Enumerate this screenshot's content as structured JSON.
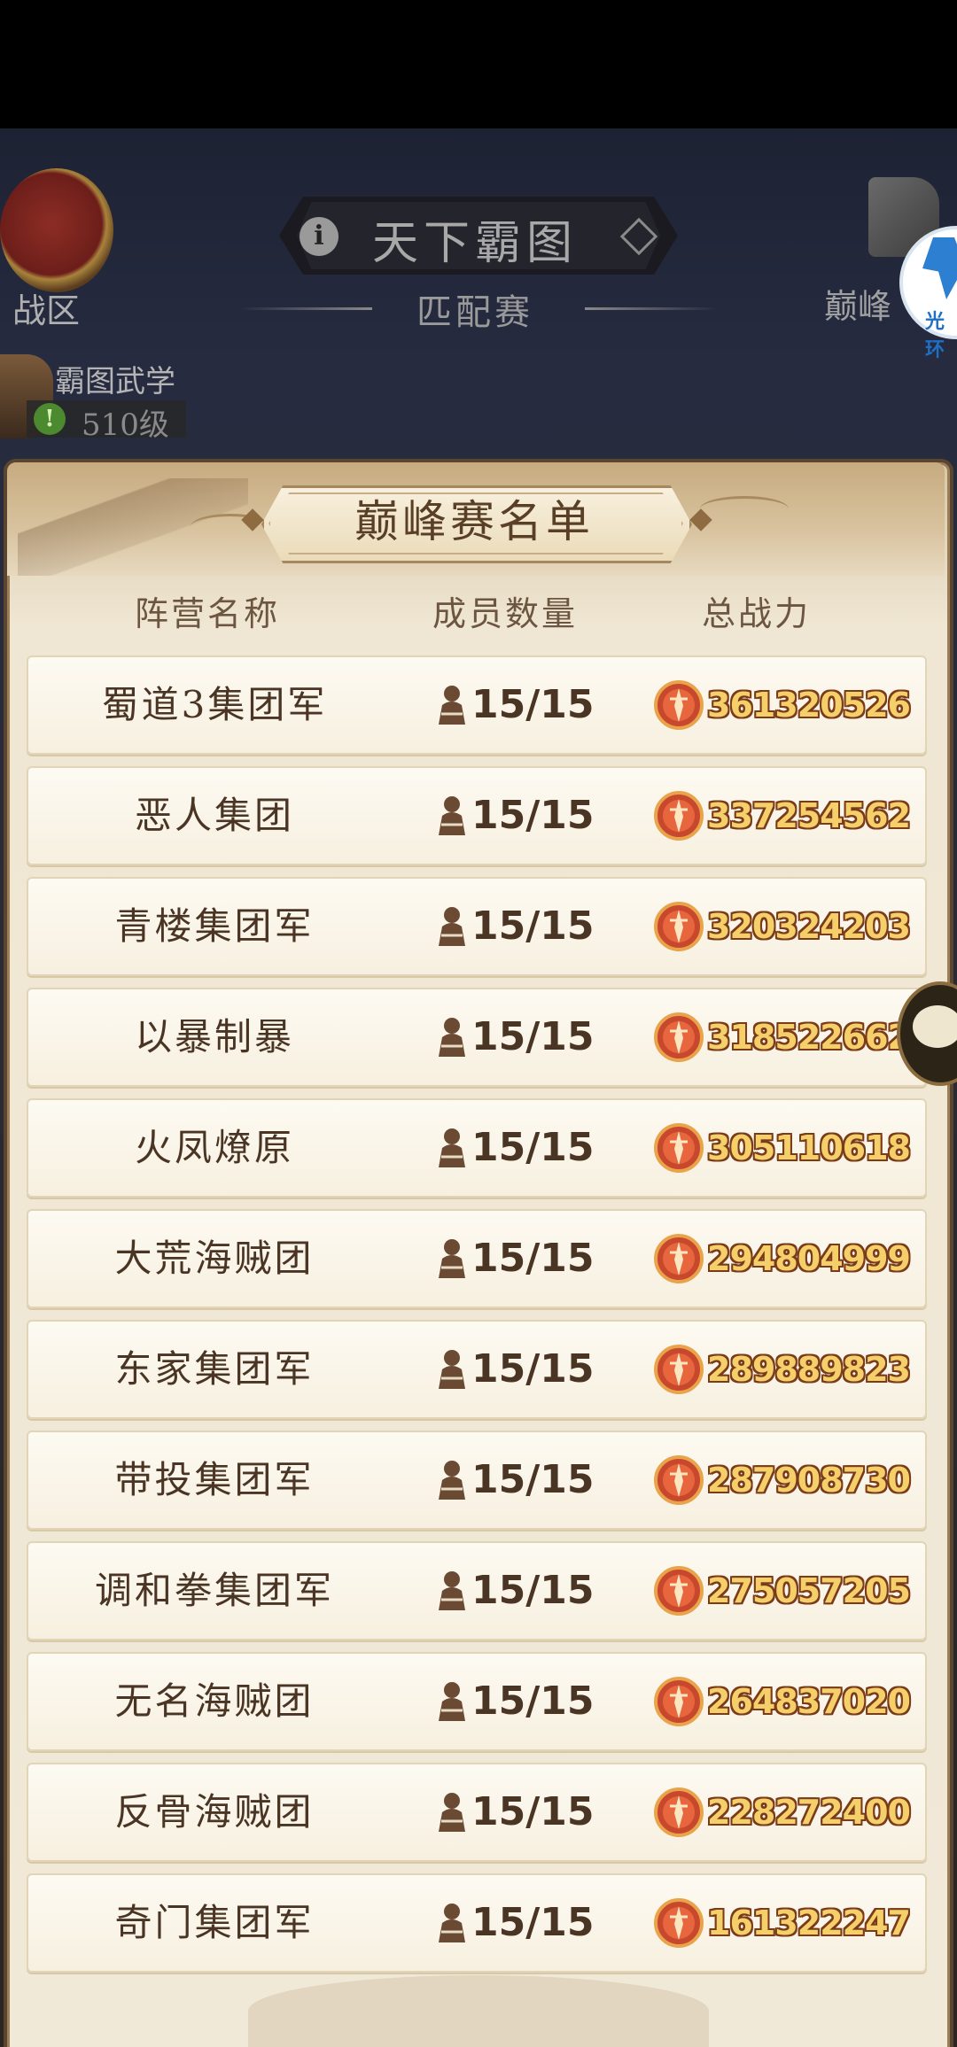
{
  "header": {
    "title": "天下霸图",
    "subtitle": "匹配赛",
    "zone_label": "战区",
    "peak_label": "巅峰",
    "side_app_text": "光环"
  },
  "martial": {
    "title": "霸图武学",
    "level": "510级"
  },
  "panel": {
    "title": "巅峰赛名单",
    "columns": [
      "阵营名称",
      "成员数量",
      "总战力"
    ]
  },
  "rows": [
    {
      "name": "蜀道3集团军",
      "members": "15/15",
      "power": "361320526"
    },
    {
      "name": "恶人集团",
      "members": "15/15",
      "power": "337254562"
    },
    {
      "name": "青楼集团军",
      "members": "15/15",
      "power": "320324203"
    },
    {
      "name": "以暴制暴",
      "members": "15/15",
      "power": "318522662"
    },
    {
      "name": "火凤燎原",
      "members": "15/15",
      "power": "305110618"
    },
    {
      "name": "大荒海贼团",
      "members": "15/15",
      "power": "294804999"
    },
    {
      "name": "东家集团军",
      "members": "15/15",
      "power": "289889823"
    },
    {
      "name": "带投集团军",
      "members": "15/15",
      "power": "287908730"
    },
    {
      "name": "调和拳集团军",
      "members": "15/15",
      "power": "275057205"
    },
    {
      "name": "无名海贼团",
      "members": "15/15",
      "power": "264837020"
    },
    {
      "name": "反骨海贼团",
      "members": "15/15",
      "power": "228272400"
    },
    {
      "name": "奇门集团军",
      "members": "15/15",
      "power": "161322247"
    }
  ],
  "icons": {
    "info": "info-icon",
    "member": "member-icon",
    "power": "power-icon",
    "chat": "chat-icon"
  },
  "colors": {
    "power_text": "#f4cf6a",
    "panel_bg": "#f1e9d8",
    "row_text": "#4a3524"
  }
}
